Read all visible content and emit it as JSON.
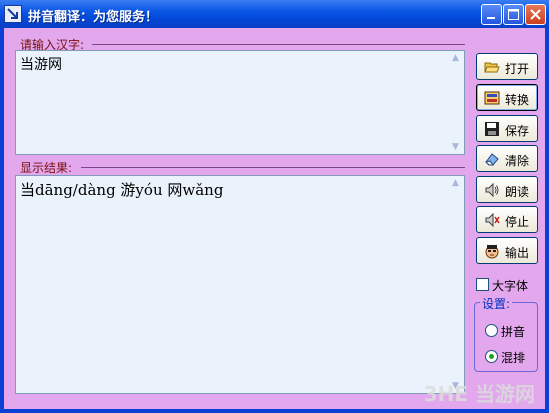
{
  "window": {
    "title": "拼音翻译：为您服务！"
  },
  "input_group": {
    "label": "请输入汉字:",
    "text": "当游网"
  },
  "result_group": {
    "label": "显示结果:",
    "text": "当dāng/dàng 游yóu 网wǎng"
  },
  "buttons": [
    {
      "label": "打开",
      "icon": "open-folder-icon"
    },
    {
      "label": "转换",
      "icon": "convert-icon"
    },
    {
      "label": "保存",
      "icon": "floppy-disk-icon"
    },
    {
      "label": "清除",
      "icon": "eraser-icon"
    },
    {
      "label": "朗读",
      "icon": "speaker-icon"
    },
    {
      "label": "停止",
      "icon": "speaker-stop-icon"
    },
    {
      "label": "输出",
      "icon": "face-icon"
    }
  ],
  "options": {
    "large_font_label": "大字体",
    "large_font_checked": false,
    "settings_title": "设置:",
    "radios": [
      {
        "label": "拼音",
        "checked": false
      },
      {
        "label": "混排",
        "checked": true
      }
    ]
  },
  "watermark": "3HE 当游网"
}
